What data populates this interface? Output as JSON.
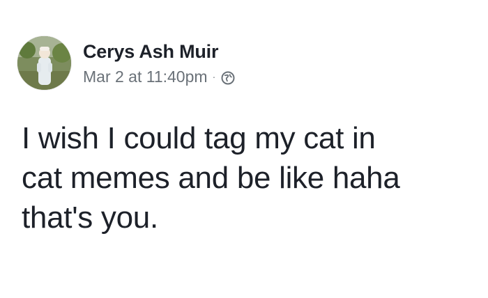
{
  "post": {
    "author": "Cerys Ash Muir",
    "timestamp": "Mar 2 at 11:40pm",
    "separator": "·",
    "privacy_icon": "globe-icon",
    "text_lines": [
      "I wish I could tag my cat in",
      "cat memes and be like haha",
      "that's you."
    ]
  },
  "colors": {
    "name": "#1d2129",
    "meta": "#6a7178",
    "body": "#1d2129"
  }
}
